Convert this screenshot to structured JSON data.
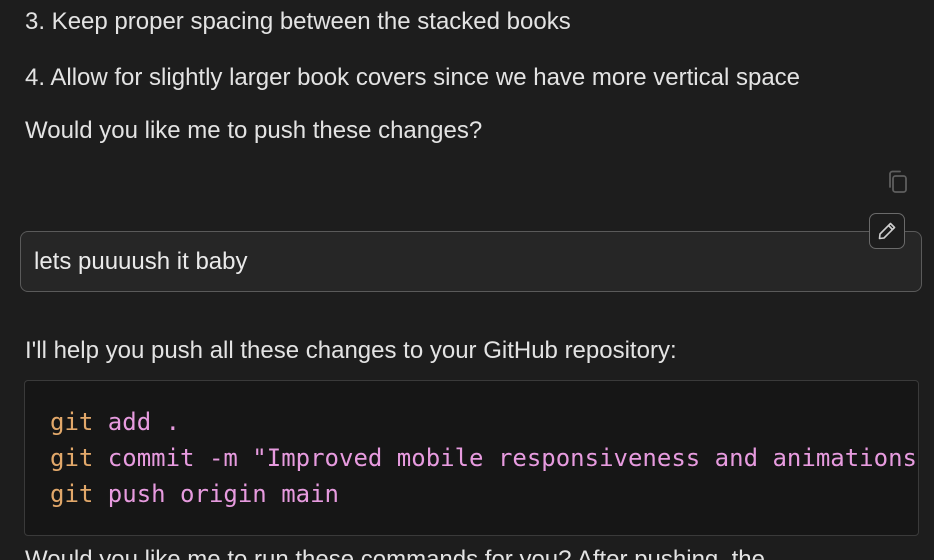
{
  "assistant_prev": {
    "item3": "3. Keep proper spacing between the stacked books",
    "item4": "4. Allow for slightly larger book covers since we have more vertical space",
    "question": "Would you like me to push these changes?"
  },
  "actions": {
    "copy_icon": "copy-icon",
    "edit_icon": "pencil-icon"
  },
  "user_message": {
    "text": "lets puuuush it baby"
  },
  "assistant_reply": {
    "intro": "I'll help you push all these changes to your GitHub repository:",
    "code": [
      {
        "cmd": "git",
        "args": " add ."
      },
      {
        "cmd": "git",
        "args": " commit -m \"Improved mobile responsiveness and animations\""
      },
      {
        "cmd": "git",
        "args": " push origin main"
      }
    ],
    "followup": "Would you like me to run these commands for you? After pushing, the"
  },
  "colors": {
    "background": "#1d1d1d",
    "text": "#e3e3e3",
    "code_command": "#e2a86a",
    "code_argument": "#e79bdf",
    "border": "#5a5a5a"
  }
}
